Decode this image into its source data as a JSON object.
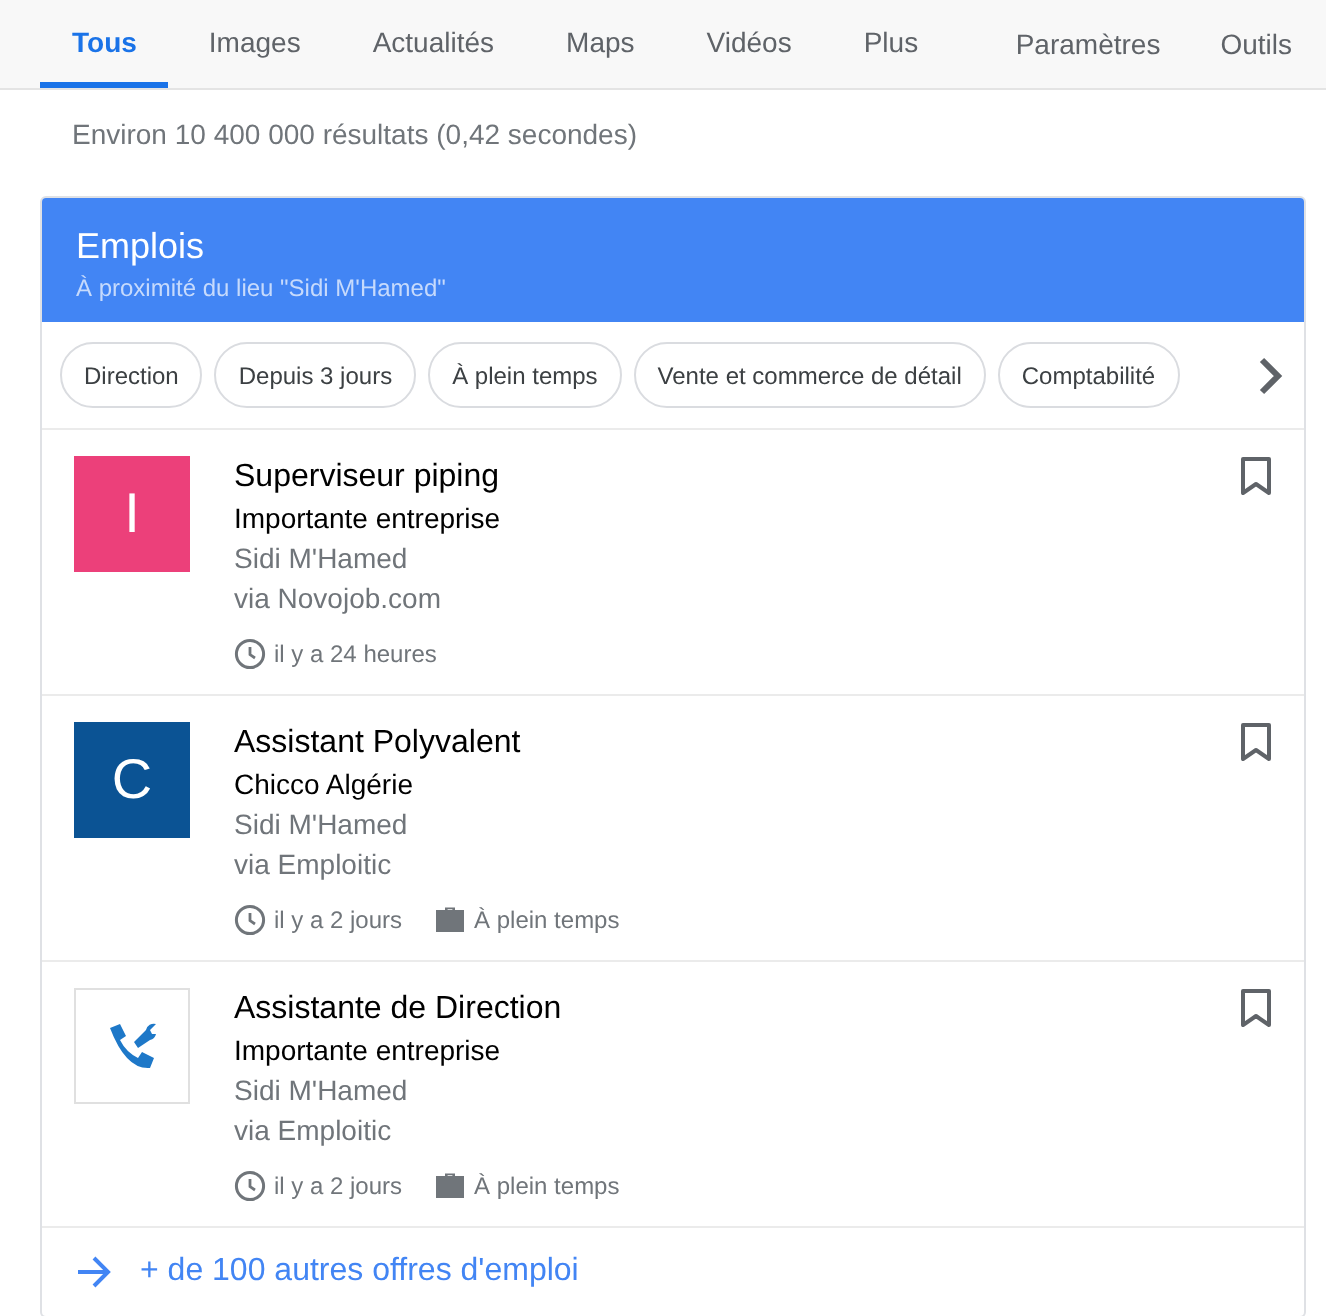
{
  "tabs": [
    {
      "label": "Tous",
      "selected": true
    },
    {
      "label": "Images",
      "selected": false
    },
    {
      "label": "Actualités",
      "selected": false
    },
    {
      "label": "Maps",
      "selected": false
    },
    {
      "label": "Vidéos",
      "selected": false
    },
    {
      "label": "Plus",
      "selected": false
    }
  ],
  "tools": [
    "Paramètres",
    "Outils"
  ],
  "result_stats": "Environ 10 400 000 résultats (0,42 secondes)",
  "jobs_card": {
    "title": "Emplois",
    "subtitle": "À proximité du lieu \"Sidi M'Hamed\"",
    "filters": [
      "Direction",
      "Depuis 3 jours",
      "À plein temps",
      "Vente et commerce de détail",
      "Comptabilité"
    ],
    "jobs": [
      {
        "logo": {
          "kind": "letter",
          "letter": "I",
          "color": "#ec407a"
        },
        "title": "Superviseur piping",
        "company": "Importante entreprise",
        "location": "Sidi M'Hamed",
        "source": "via Novojob.com",
        "posted": "il y a 24 heures"
      },
      {
        "logo": {
          "kind": "letter",
          "letter": "C",
          "color": "#0b5394"
        },
        "title": "Assistant Polyvalent",
        "company": "Chicco Algérie",
        "location": "Sidi M'Hamed",
        "source": "via Emploitic",
        "posted": "il y a 2 jours",
        "schedule": "À plein temps"
      },
      {
        "logo": {
          "kind": "icon"
        },
        "title": "Assistante de Direction",
        "company": "Importante entreprise",
        "location": "Sidi M'Hamed",
        "source": "via Emploitic",
        "posted": "il y a 2 jours",
        "schedule": "À plein temps"
      }
    ],
    "more_link": "+ de 100 autres offres d'emploi"
  }
}
